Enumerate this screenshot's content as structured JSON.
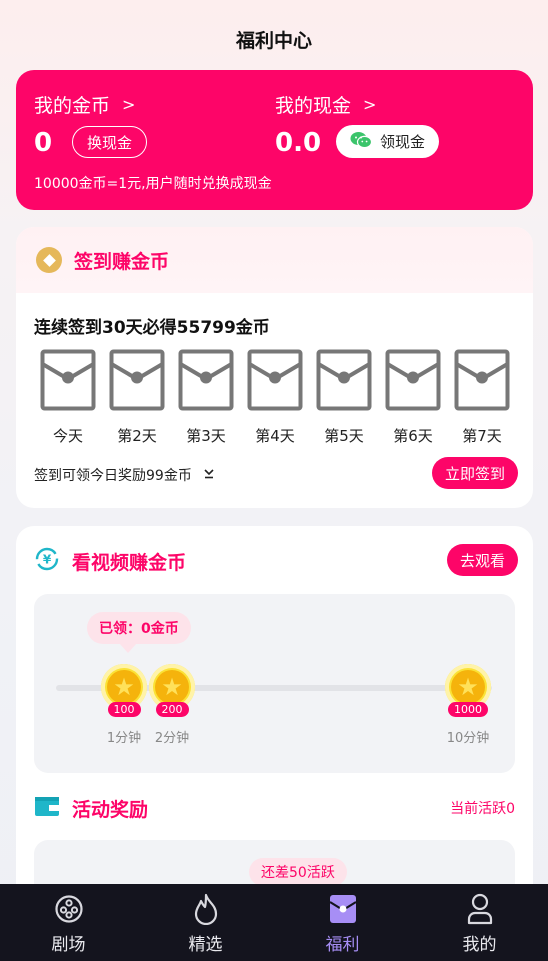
{
  "header": {
    "title": "福利中心"
  },
  "coins": {
    "my_coins_label": "我的金币",
    "my_coins_value": "0",
    "exchange_label": "换现金",
    "my_cash_label": "我的现金",
    "my_cash_value": "0.0",
    "withdraw_label": "领现金",
    "chevron": ">",
    "note": "10000金币=1元,用户随时兑换成现金",
    "accent_color": "#fd0568"
  },
  "signin": {
    "title": "签到赚金币",
    "subtitle": "连续签到30天必得55799金币",
    "days": [
      "今天",
      "第2天",
      "第3天",
      "第4天",
      "第5天",
      "第6天",
      "第7天"
    ],
    "tip": "签到可领今日奖励99金币",
    "button": "立即签到"
  },
  "video": {
    "title": "看视频赚金币",
    "button": "去观看",
    "claimed": "已领：0金币",
    "milestones": [
      {
        "reward": "100",
        "time": "1分钟"
      },
      {
        "reward": "200",
        "time": "2分钟"
      },
      {
        "reward": "1000",
        "time": "10分钟"
      }
    ]
  },
  "activity": {
    "title": "活动奖励",
    "current": "当前活跃0",
    "remaining": "还差50活跃"
  },
  "nav": {
    "items": [
      {
        "label": "剧场",
        "icon": "film-reel-icon"
      },
      {
        "label": "精选",
        "icon": "flame-icon"
      },
      {
        "label": "福利",
        "icon": "red-envelope-icon"
      },
      {
        "label": "我的",
        "icon": "person-icon"
      }
    ],
    "active_index": 2,
    "active_color": "#a78ef5"
  }
}
